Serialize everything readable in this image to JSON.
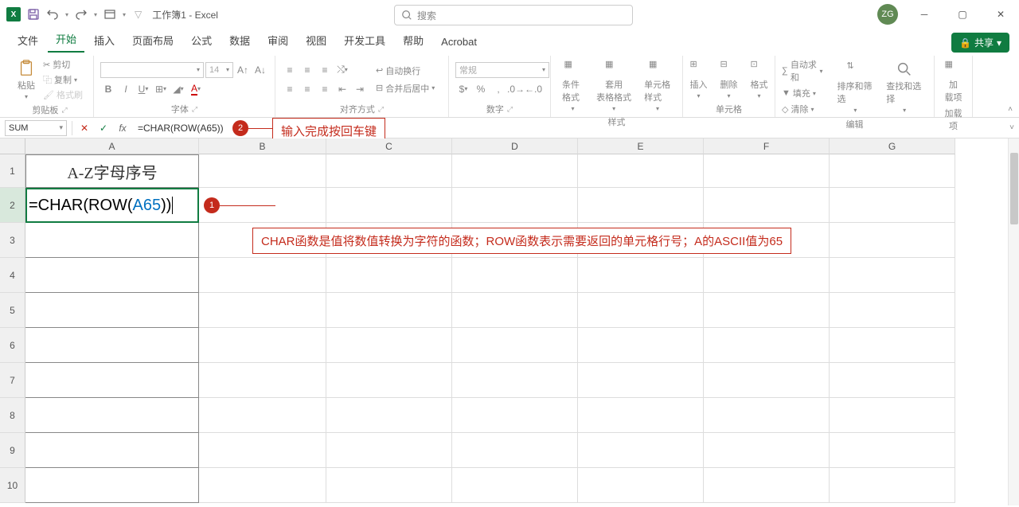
{
  "titlebar": {
    "app_initial": "X",
    "doc_title": "工作簿1 - Excel",
    "search_placeholder": "搜索",
    "avatar": "ZG"
  },
  "tabs": {
    "file": "文件",
    "home": "开始",
    "insert": "插入",
    "layout": "页面布局",
    "formula": "公式",
    "data": "数据",
    "review": "审阅",
    "view": "视图",
    "dev": "开发工具",
    "help": "帮助",
    "acrobat": "Acrobat",
    "share": "共享"
  },
  "ribbon": {
    "paste": "粘贴",
    "cut": "剪切",
    "copy": "复制",
    "format_painter": "格式刷",
    "clipboard": "剪贴板",
    "font_size": "14",
    "font_group": "字体",
    "align_group": "对齐方式",
    "wrap": "自动换行",
    "merge": "合并后居中",
    "number_format": "常规",
    "number_group": "数字",
    "cond_format": "条件格式",
    "table_format": "套用\n表格格式",
    "cell_style": "单元格样式",
    "styles_group": "样式",
    "insert_btn": "插入",
    "delete_btn": "删除",
    "format_btn": "格式",
    "cells_group": "单元格",
    "autosum": "自动求和",
    "fill": "填充",
    "clear": "清除",
    "edit_group": "编辑",
    "sort_filter": "排序和筛选",
    "find_select": "查找和选择",
    "addins": "加\n载项",
    "addins_group": "加载项"
  },
  "fbar": {
    "name_box": "SUM",
    "formula": "=CHAR(ROW(A65))"
  },
  "annotations": {
    "badge1": "1",
    "text1": "CHAR函数是值将数值转换为字符的函数；ROW函数表示需要返回的单元格行号；A的ASCII值为65",
    "badge2": "2",
    "text2": "输入完成按回车键"
  },
  "cols": [
    "A",
    "B",
    "C",
    "D",
    "E",
    "F",
    "G"
  ],
  "rows": [
    "1",
    "2",
    "3",
    "4",
    "5",
    "6",
    "7",
    "8",
    "9",
    "10"
  ],
  "cells": {
    "A1": "A-Z字母序号",
    "A2_prefix": "=CHAR(ROW(",
    "A2_ref": "A65",
    "A2_suffix": "))"
  }
}
